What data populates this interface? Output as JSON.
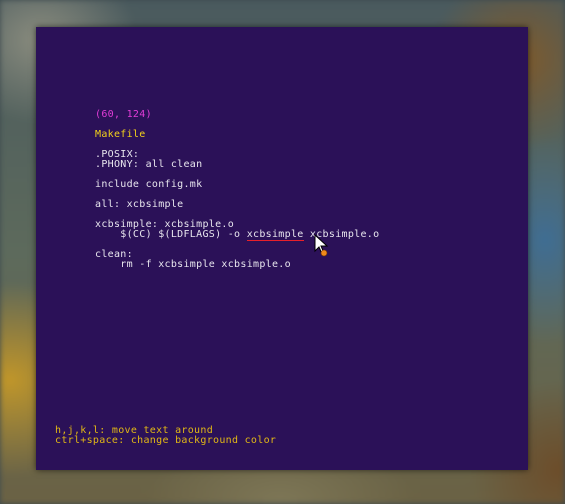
{
  "coordinates": "(60, 124)",
  "filename": "Makefile",
  "code": {
    "posix": ".POSIX:",
    "phony": ".PHONY: all clean",
    "include": "include config.mk",
    "all": "all: xcbsimple",
    "target": "xcbsimple: xcbsimple.o",
    "rule_prefix": "    $(CC) $(LDFLAGS) -o ",
    "rule_word": "xcbsimple",
    "rule_suffix": " xcbsimple.o",
    "clean": "clean:",
    "clean_cmd": "    rm -f xcbsimple xcbsimple.o"
  },
  "hints": {
    "move": "h,j,k,l: move text around",
    "color": "ctrl+space: change background color"
  },
  "colors": {
    "background": "#2b1158",
    "coordinates": "#e23dd8",
    "filename": "#f4d21a",
    "code": "#e8e6ee",
    "hints": "#e2b815",
    "underline": "#e8202a"
  }
}
